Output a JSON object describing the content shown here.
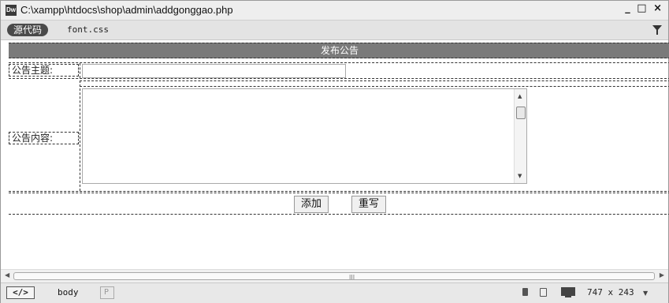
{
  "window": {
    "title": "C:\\xampp\\htdocs\\shop\\admin\\addgonggao.php",
    "app_icon": "Dw",
    "controls": "_ □ ×"
  },
  "related_files": {
    "source_code_label": "源代码",
    "css_file": "font.css"
  },
  "form": {
    "header": "发布公告",
    "title_label": "公告主题:",
    "content_label": "公告内容:",
    "add_button": "添加",
    "reset_button": "重写"
  },
  "scrollbar": {
    "grip": "III"
  },
  "status_bar": {
    "code_toggle": "</>",
    "tag_body": "body",
    "tag_p": "P",
    "window_size": "747 x 243"
  }
}
